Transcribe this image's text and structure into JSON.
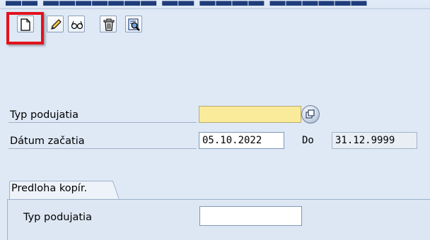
{
  "toolbar": {
    "buttons": [
      {
        "icon": "new-document-icon"
      },
      {
        "icon": "pencil-icon"
      },
      {
        "icon": "glasses-icon"
      },
      {
        "icon": "trash-icon"
      },
      {
        "icon": "search-list-icon"
      }
    ],
    "highlight_color": "#e3121c"
  },
  "form": {
    "event_type_label": "Typ podujatia",
    "event_type_value": "",
    "start_date_label": "Dátum začatia",
    "start_date_value": "05.10.2022",
    "end_date_label": "Do",
    "end_date_value": "31.12.9999"
  },
  "copy_template": {
    "tab_label": "Predloha kopír.",
    "event_type_label": "Typ podujatia",
    "event_type_value": ""
  },
  "colors": {
    "background": "#dfe9f6",
    "required_field": "#faeb9b"
  }
}
